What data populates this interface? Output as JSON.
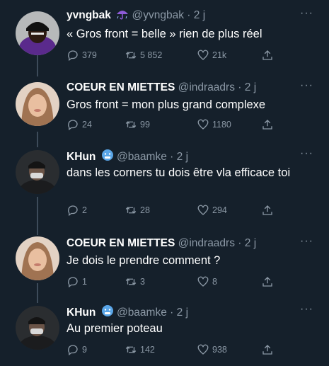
{
  "tweets": [
    {
      "name": "yvngbak",
      "emoji": "umbrella-rain-emoji",
      "handle": "@yvngbak",
      "dot": "·",
      "time": "2 j",
      "text": "« Gros front = belle » rien de plus réel",
      "replies": "379",
      "retweets": "5 852",
      "likes": "21k"
    },
    {
      "name": "COEUR EN MIETTES",
      "handle": "@indraadrs",
      "dot": "·",
      "time": "2 j",
      "text": "Gros front = mon plus grand complexe",
      "replies": "24",
      "retweets": "99",
      "likes": "1180"
    },
    {
      "name": "KHun",
      "emoji": "cold-face-emoji",
      "handle": "@baamke",
      "dot": "·",
      "time": "2 j",
      "text": "dans les corners tu dois être vla efficace toi",
      "replies": "2",
      "retweets": "28",
      "likes": "294"
    },
    {
      "name": "COEUR EN MIETTES",
      "handle": "@indraadrs",
      "dot": "·",
      "time": "2 j",
      "text": "Je dois le prendre comment ?",
      "replies": "1",
      "retweets": "3",
      "likes": "8"
    },
    {
      "name": "KHun",
      "emoji": "cold-face-emoji",
      "handle": "@baamke",
      "dot": "·",
      "time": "2 j",
      "text": "Au premier poteau",
      "replies": "9",
      "retweets": "142",
      "likes": "938"
    }
  ],
  "more_label": "···",
  "colors": {
    "background": "#15202b",
    "secondary_text": "#8b98a5",
    "thread_line": "#3d4b5a"
  }
}
